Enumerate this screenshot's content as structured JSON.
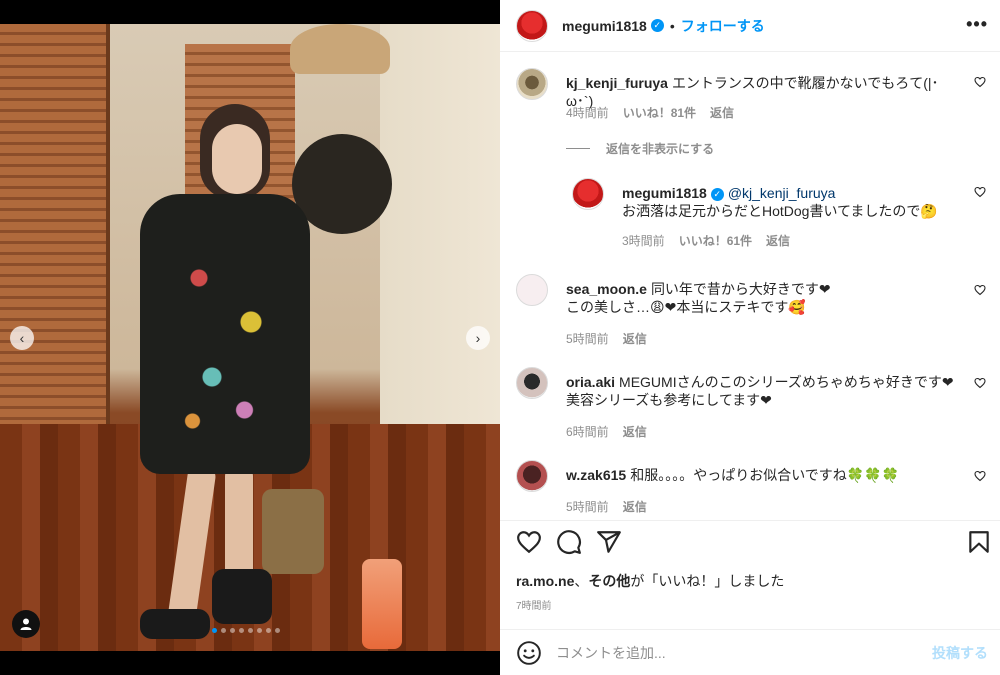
{
  "post": {
    "username": "megumi1818",
    "separator": "•",
    "follow_label": "フォローする",
    "more_label": "•••",
    "carousel": {
      "prev": "‹",
      "next": "›",
      "total_slides": 8,
      "active_index": 0
    }
  },
  "comments": [
    {
      "username": "kj_kenji_furuya",
      "text": "エントランスの中で靴履かないでもろて(|･ω･`)",
      "time": "4時間前",
      "likes": "いいね！81件",
      "reply": "返信"
    },
    {
      "hide_replies_label": "返信を非表示にする"
    },
    {
      "username": "megumi1818",
      "mention": "@kj_kenji_furuya",
      "text": "お洒落は足元からだとHotDog書いてましたので🤔",
      "time": "3時間前",
      "likes": "いいね！61件",
      "reply": "返信"
    },
    {
      "username": "sea_moon.e",
      "text_line1": "同い年で昔から大好きです❤",
      "text_line2": "この美しさ…😩❤本当にステキです🥰",
      "time": "5時間前",
      "reply": "返信"
    },
    {
      "username": "oria.aki",
      "text_line1": "MEGUMIさんのこのシリーズめちゃめちゃ好きです❤",
      "text_line2": "美容シリーズも参考にしてます❤",
      "time": "6時間前",
      "reply": "返信"
    },
    {
      "username": "w.zak615",
      "text": "和服。。。。やっぱりお似合いですね🍀🍀🍀",
      "time": "5時間前",
      "reply": "返信"
    }
  ],
  "footer": {
    "liked_by_user": "ra.mo.ne",
    "liked_by_sep": "、",
    "liked_by_others": "その他",
    "liked_by_suffix": "が「いいね！」しました",
    "time": "7時間前",
    "comment_placeholder": "コメントを追加...",
    "post_label": "投稿する"
  },
  "icons": {
    "verified": "verified-badge-icon",
    "like": "heart-icon",
    "comment": "comment-bubble-icon",
    "share": "paper-plane-icon",
    "save": "bookmark-icon",
    "emoji": "smiley-icon",
    "user_tag": "person-icon"
  },
  "colors": {
    "accent": "#0095f6",
    "post_disabled": "#b2dffc",
    "muted": "#8e8e8e",
    "text": "#262626"
  }
}
